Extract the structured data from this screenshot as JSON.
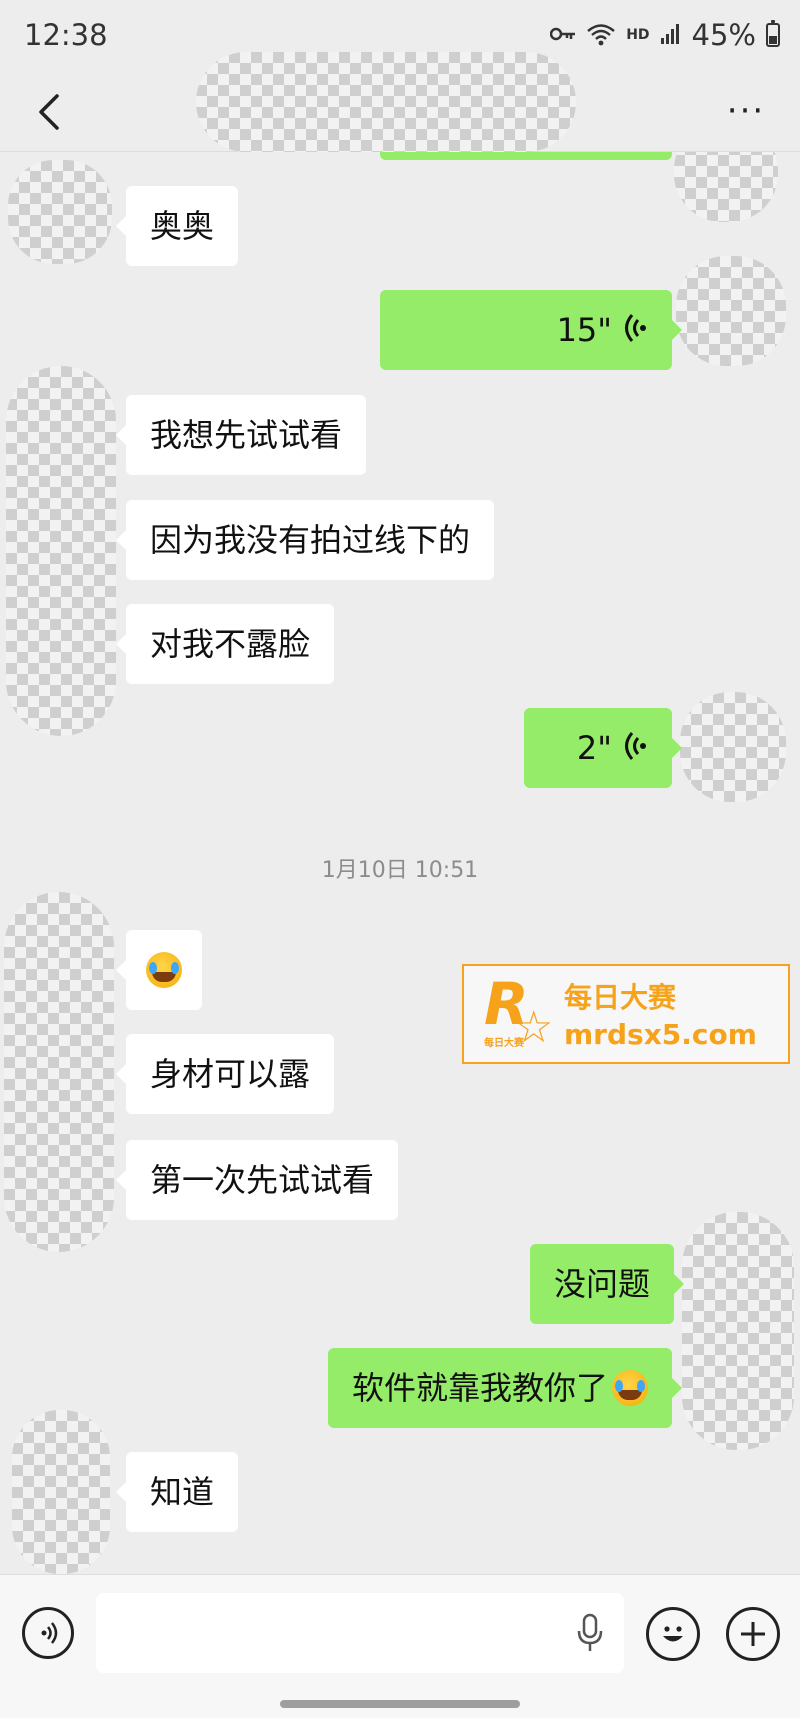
{
  "status_bar": {
    "time": "12:38",
    "battery": "45%",
    "battery_level": 0.45,
    "hd_label": "HD",
    "icons": [
      "key-icon",
      "wifi-icon",
      "signal-icon",
      "battery-icon"
    ]
  },
  "nav": {
    "back_icon": "chevron-left-icon",
    "more_label": "···"
  },
  "messages": [
    {
      "side": "incoming",
      "type": "text",
      "text": "奥奥"
    },
    {
      "side": "outgoing",
      "type": "voice",
      "duration": "15\""
    },
    {
      "side": "incoming",
      "type": "text",
      "text": "我想先试试看"
    },
    {
      "side": "incoming",
      "type": "text",
      "text": "因为我没有拍过线下的"
    },
    {
      "side": "incoming",
      "type": "text",
      "text": "对我不露脸"
    },
    {
      "side": "outgoing",
      "type": "voice",
      "duration": "2\""
    },
    {
      "side": "incoming",
      "type": "emoji",
      "emoji": "laugh-cry-emoji"
    },
    {
      "side": "incoming",
      "type": "text",
      "text": "身材可以露"
    },
    {
      "side": "incoming",
      "type": "text",
      "text": "第一次先试试看"
    },
    {
      "side": "outgoing",
      "type": "text",
      "text": "没问题"
    },
    {
      "side": "outgoing",
      "type": "text-emoji",
      "text": "软件就靠我教你了",
      "emoji": "laugh-cry-emoji"
    },
    {
      "side": "incoming",
      "type": "text",
      "text": "知道"
    }
  ],
  "timestamp": "1月10日 10:51",
  "watermark": {
    "logo_letter": "R",
    "logo_sub": "每日大赛",
    "title": "每日大赛",
    "url": "mrdsx5.com",
    "color": "#f6a21b"
  },
  "input_bar": {
    "voice_icon": "voice-mode-icon",
    "mic_icon": "microphone-icon",
    "emoji_icon": "smiley-icon",
    "plus_icon": "plus-icon",
    "placeholder": ""
  },
  "colors": {
    "outgoing_bubble": "#95ec69",
    "incoming_bubble": "#ffffff",
    "background": "#ededed"
  }
}
